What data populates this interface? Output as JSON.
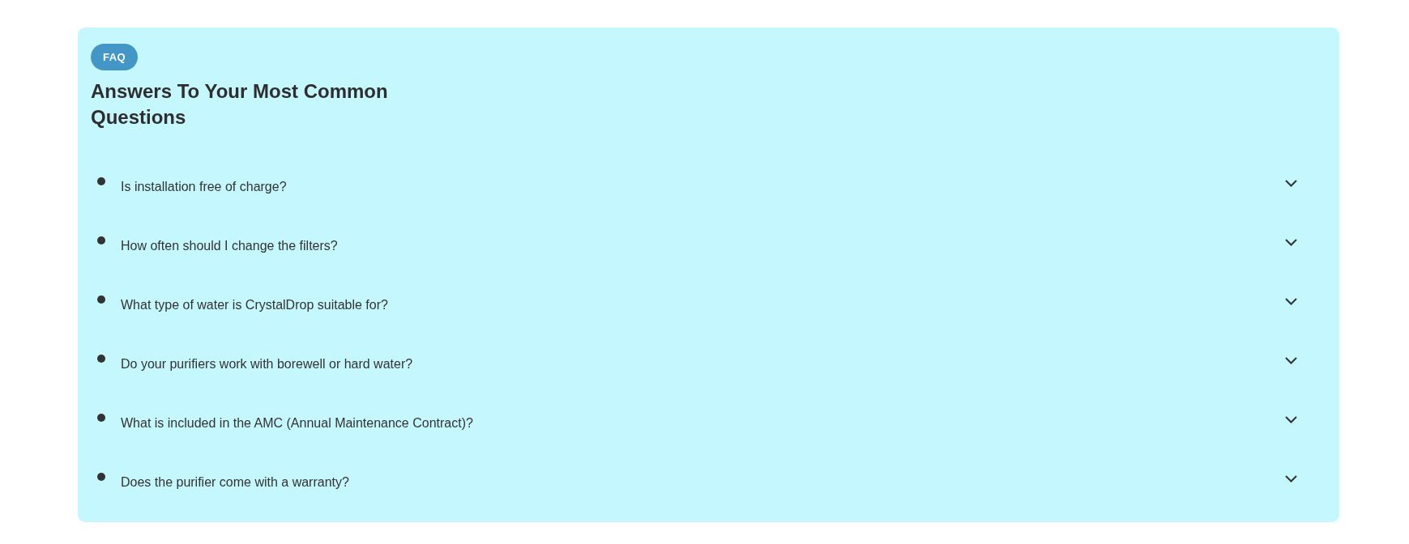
{
  "badge": "FAQ",
  "heading": "Answers To Your Most Common Questions",
  "questions": [
    {
      "text": "Is installation free of charge?",
      "expanded": false
    },
    {
      "text": "How often should I change the filters?",
      "expanded": false
    },
    {
      "text": "What type of water is CrystalDrop suitable for?",
      "expanded": false
    },
    {
      "text": "Do your purifiers work with borewell or hard water?",
      "expanded": false
    },
    {
      "text": "What is included in the AMC (Annual Maintenance Contract)?",
      "expanded": false
    },
    {
      "text": "Does the purifier come with a warranty?",
      "expanded": false
    }
  ]
}
